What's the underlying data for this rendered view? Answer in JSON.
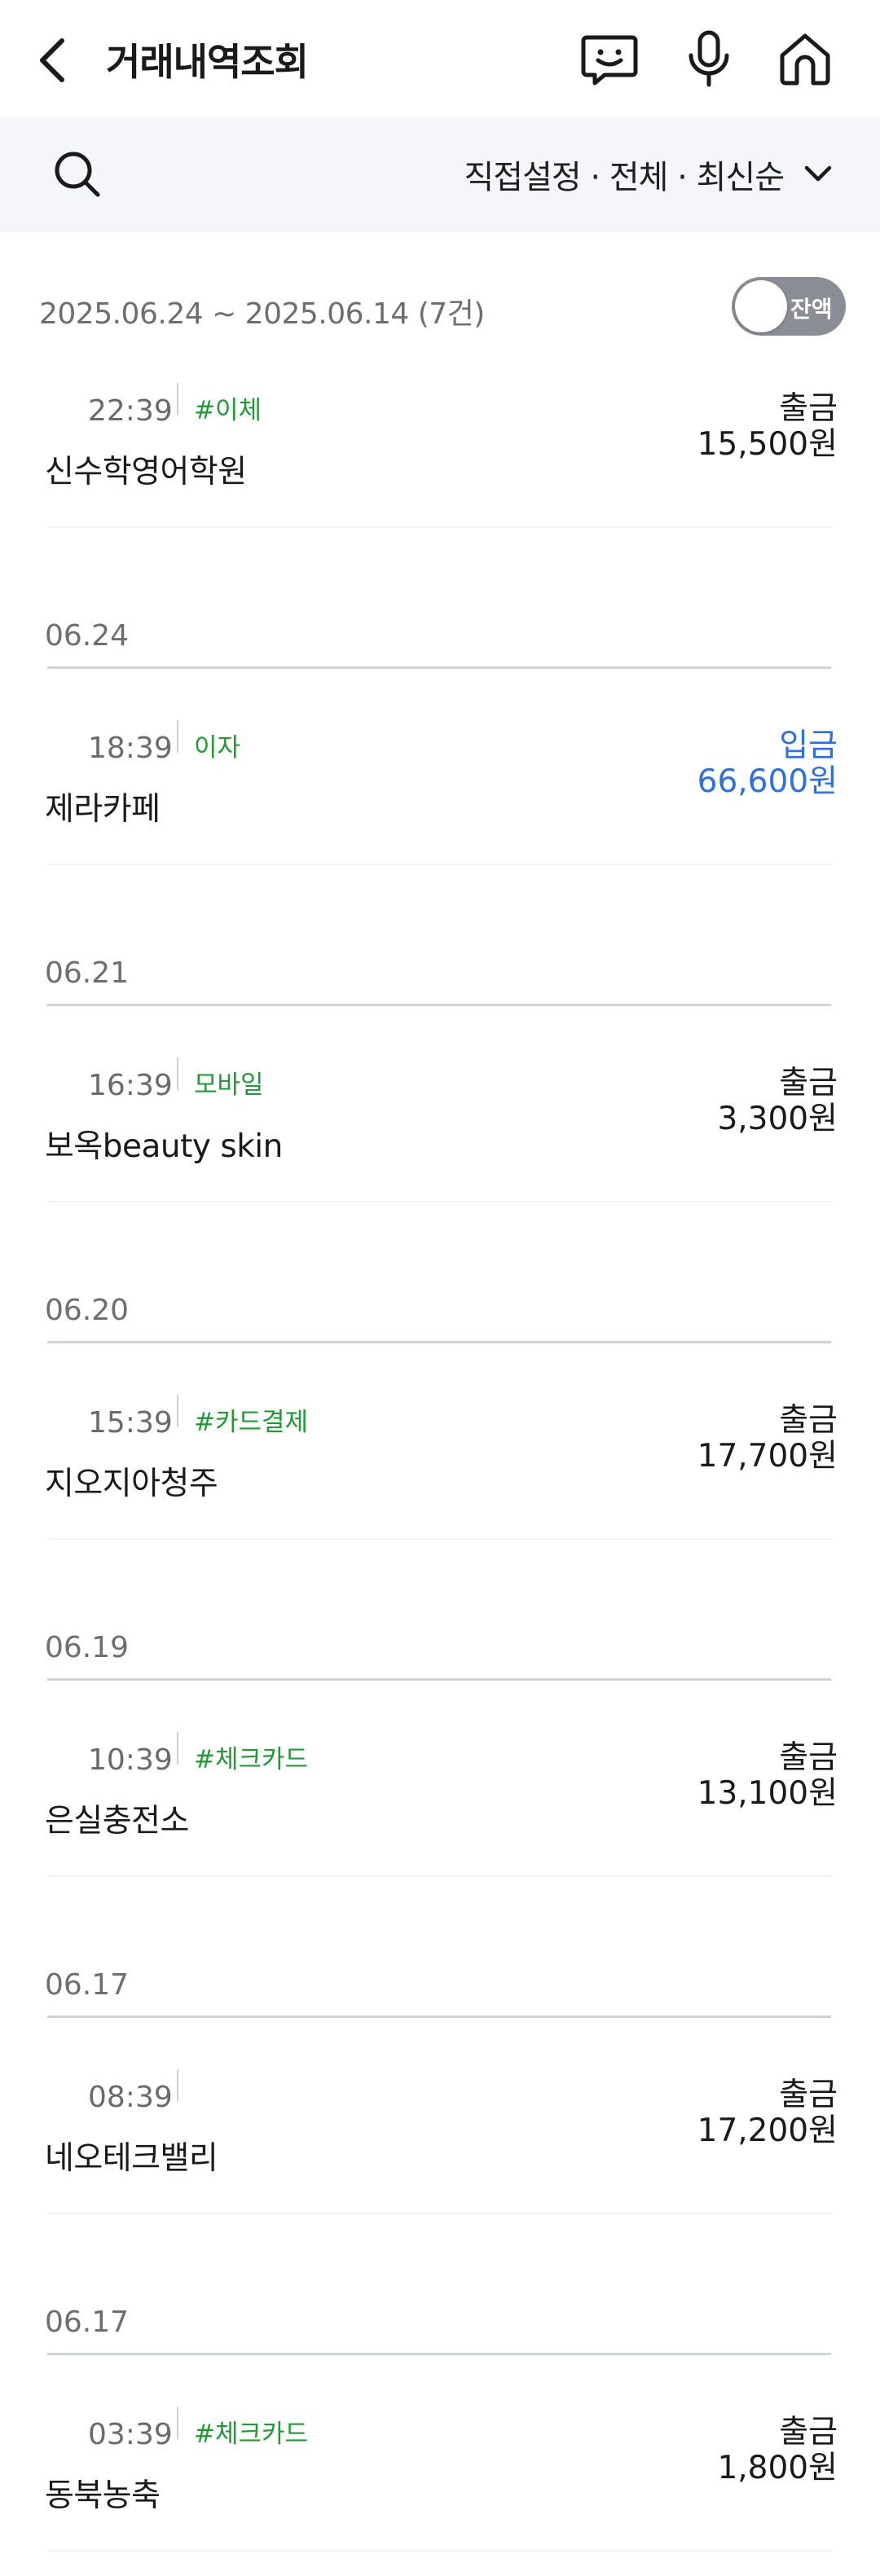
{
  "header": {
    "title": "거래내역조회",
    "icons": [
      "back-arrow-icon",
      "chatbot-icon",
      "microphone-icon",
      "home-icon"
    ]
  },
  "filter": {
    "summary": "직접설정 · 전체 · 최신순"
  },
  "range": {
    "text": "2025.06.24 ~ 2025.06.14 (7건)",
    "balance_toggle_label": "잔액",
    "balance_toggle_on": false
  },
  "colors": {
    "deposit": "#2f6fe0",
    "tag": "#1f9a35",
    "filter_bg": "#f4f6fa"
  },
  "dates": [
    "06.24",
    "06.21",
    "06.20",
    "06.19",
    "06.17",
    "06.17"
  ],
  "transactions": [
    {
      "time": "22:39",
      "tag": "#이체",
      "merchant": "신수학영어학원",
      "type": "출금",
      "amount": "15,500원"
    },
    {
      "time": "18:39",
      "tag": "이자",
      "merchant": "제라카페",
      "type": "입금",
      "amount": "66,600원"
    },
    {
      "time": "16:39",
      "tag": "모바일",
      "merchant": "보옥beauty skin",
      "type": "출금",
      "amount": "3,300원"
    },
    {
      "time": "15:39",
      "tag": "#카드결제",
      "merchant": "지오지아청주",
      "type": "출금",
      "amount": "17,700원"
    },
    {
      "time": "10:39",
      "tag": "#체크카드",
      "merchant": "은실충전소",
      "type": "출금",
      "amount": "13,100원"
    },
    {
      "time": "08:39",
      "tag": "",
      "merchant": "네오테크밸리",
      "type": "출금",
      "amount": "17,200원"
    },
    {
      "time": "03:39",
      "tag": "#체크카드",
      "merchant": "동북농축",
      "type": "출금",
      "amount": "1,800원"
    }
  ]
}
